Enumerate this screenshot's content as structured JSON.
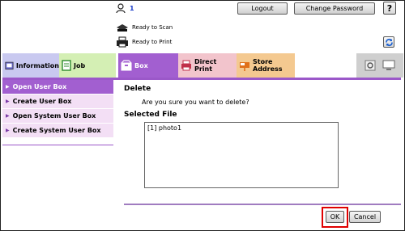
{
  "header": {
    "user_count": "1",
    "logout_label": "Logout",
    "change_password_label": "Change Password",
    "help_label": "?",
    "status_scan": "Ready to Scan",
    "status_print": "Ready to Print"
  },
  "tabs": [
    {
      "label": "Information"
    },
    {
      "label": "Job"
    },
    {
      "label": "Box"
    },
    {
      "label": "Direct Print"
    },
    {
      "label": "Store Address"
    }
  ],
  "sidebar": {
    "items": [
      {
        "label": "Open User Box"
      },
      {
        "label": "Create User Box"
      },
      {
        "label": "Open System User Box"
      },
      {
        "label": "Create System User Box"
      }
    ]
  },
  "main": {
    "title": "Delete",
    "message": "Are you sure you want to delete?",
    "selected_label": "Selected File",
    "files": [
      "[1] photo1"
    ],
    "ok_label": "OK",
    "cancel_label": "Cancel"
  },
  "colors": {
    "accent": "#a25fd0",
    "highlight": "#e00000"
  }
}
